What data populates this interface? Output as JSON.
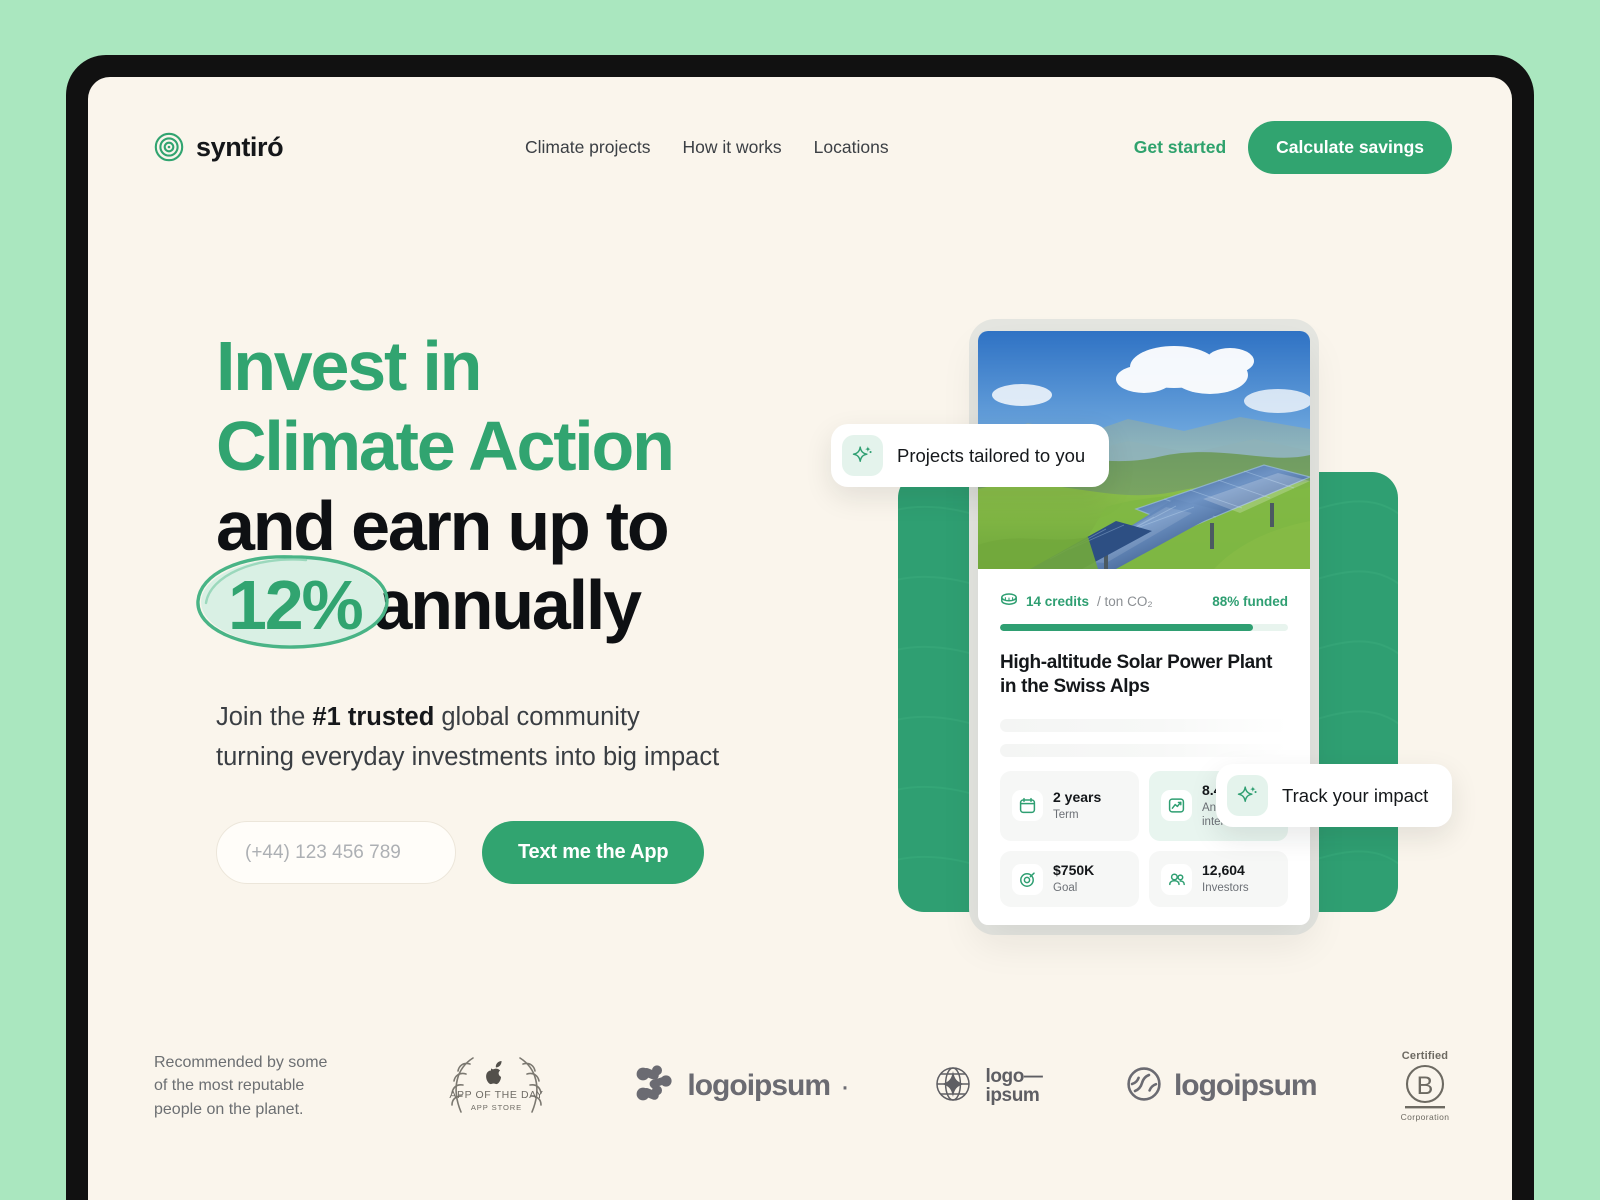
{
  "brand": {
    "name": "syntiró",
    "icon": "concentric-target-icon"
  },
  "nav": {
    "links": [
      {
        "label": "Climate projects"
      },
      {
        "label": "How it works"
      },
      {
        "label": "Locations"
      }
    ],
    "get_started": "Get started",
    "calculate_savings": "Calculate savings"
  },
  "hero": {
    "headline_line1": "Invest in",
    "headline_line2": "Climate Action",
    "headline_line3": "and earn up to",
    "headline_highlight": "12%",
    "headline_line4_tail": "annually",
    "sub_part1": "Join the ",
    "sub_bold": "#1 trusted",
    "sub_part2": " global community",
    "sub_line2": "turning everyday investments into big impact",
    "phone_placeholder": "(+44) 123 456 789",
    "phone_value": "",
    "cta_label": "Text me the App"
  },
  "pills": [
    {
      "text": "Projects tailored to you",
      "icon": "sparkle-icon"
    },
    {
      "text": "Track your impact",
      "icon": "sparkle-icon"
    }
  ],
  "card": {
    "credits_value": "14 credits",
    "credits_unit": "/ ton CO₂",
    "credits_icon": "coin-stack-icon",
    "funded": "88% funded",
    "progress_percent": 88,
    "title": "High-altitude Solar Power Plant in the Swiss Alps",
    "photo_alt": "solar-panels-on-green-mountain-slope",
    "stats": [
      {
        "value": "2 years",
        "label": "Term",
        "icon": "calendar-icon",
        "accent": false
      },
      {
        "value": "8.4%",
        "label": "Annual interest",
        "icon": "chart-up-icon",
        "accent": true
      },
      {
        "value": "$750K",
        "label": "Goal",
        "icon": "target-icon",
        "accent": false
      },
      {
        "value": "12,604",
        "label": "Investors",
        "icon": "users-icon",
        "accent": false
      }
    ]
  },
  "footer": {
    "recommend_line1": "Recommended by some",
    "recommend_line2": "of the most reputable",
    "recommend_line3": "people on the planet.",
    "logos": [
      {
        "id": "app-of-the-day",
        "line1": "APP OF THE DAY",
        "line2": "APP STORE"
      },
      {
        "id": "logoipsum-dots",
        "word": "logoipsum"
      },
      {
        "id": "logoipsum-globe",
        "word_line1": "logo—",
        "word_line2": "ipsum"
      },
      {
        "id": "logoipsum-swirl",
        "word": "logoipsum"
      },
      {
        "id": "b-corporation",
        "top": "Certified",
        "letter": "B",
        "bottom": "Corporation"
      }
    ]
  },
  "colors": {
    "page_bg": "#faf5ec",
    "outer_bg": "#aae7bf",
    "accent_green": "#31a470",
    "slab_green": "#2f9f72",
    "text_dark": "#0e1013",
    "muted": "#6c6f72"
  }
}
